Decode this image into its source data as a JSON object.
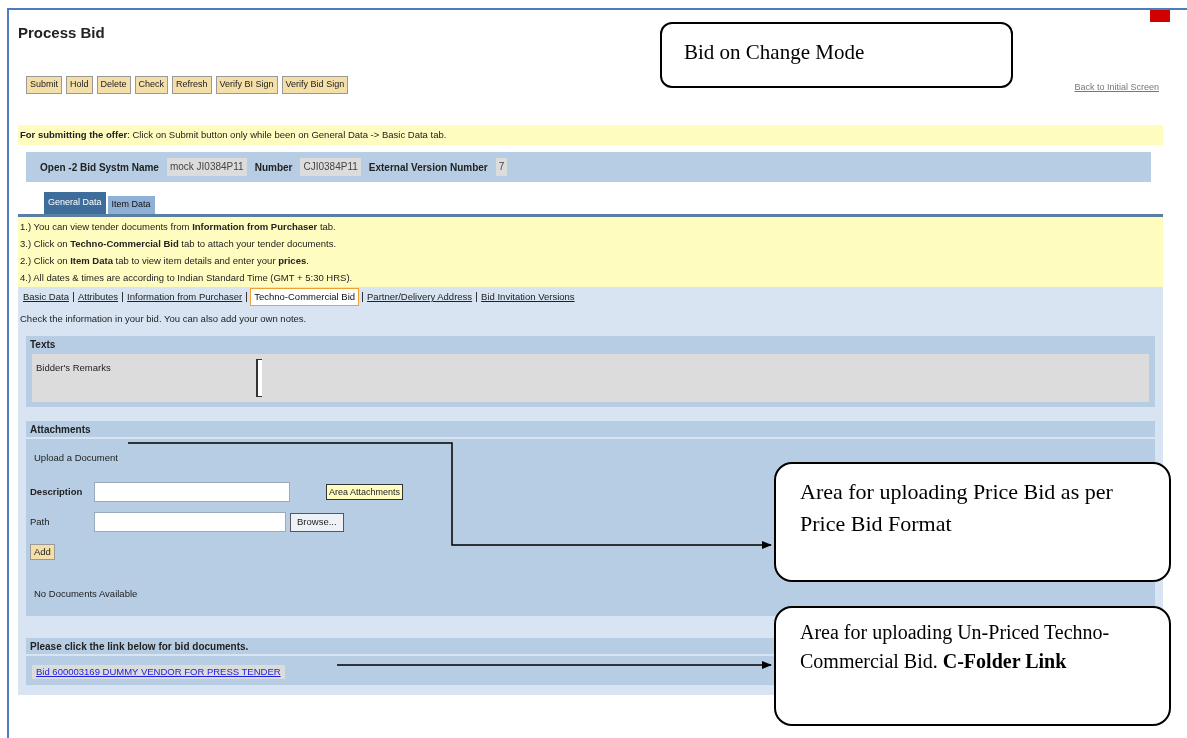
{
  "title": "Process Bid",
  "toolbar": [
    "Submit",
    "Hold",
    "Delete",
    "Check",
    "Refresh",
    "Verify BI Sign",
    "Verify Bid Sign"
  ],
  "back_link": "Back to Initial Screen",
  "submit_note": "**For submitting the offer**: Click on Submit button only while been on General Data -> Basic Data tab.",
  "header_fields": [
    {
      "label": "Open -2 Bid Systm Name",
      "value": "mock JI0384P11"
    },
    {
      "label": "Number",
      "value": "CJI0384P11"
    },
    {
      "label": "External Version Number",
      "value": "7"
    }
  ],
  "tabs": [
    {
      "label": "General Data",
      "selected": true
    },
    {
      "label": "Item Data",
      "selected": false
    }
  ],
  "info_lines": [
    "1.) You can view tender documents from **Information from Purchaser** tab.",
    "3.) Click on **Techno-Commercial Bid** tab to attach your tender documents.",
    "2.) Click on **Item Data** tab to view item details and enter your **prices**.",
    "4.) All dates & times are according to Indian Standard Time (GMT + 5:30 HRS)."
  ],
  "subtabs": [
    {
      "label": "Basic Data",
      "selected": false
    },
    {
      "label": "Attributes",
      "selected": false
    },
    {
      "label": "Information from Purchaser",
      "selected": false
    },
    {
      "label": "Techno-Commercial Bid",
      "selected": true
    },
    {
      "label": "Partner/Delivery Address",
      "selected": false
    },
    {
      "label": "Bid Invitation Versions",
      "selected": false
    }
  ],
  "intro": "Check the information in your bid. You can also add your own notes.",
  "texts_section": {
    "title": "Texts",
    "field_label": "Bidder's Remarks"
  },
  "attachments": {
    "title": "Attachments",
    "upload_label": "Upload a Document",
    "description_label": "Description",
    "area_button": "Area Attachments",
    "path_label": "Path",
    "browse_button": "Browse...",
    "add_button": "Add",
    "empty_text": "No Documents Available"
  },
  "links_section": {
    "title": "Please click the link below for bid documents.",
    "link": "Bid 600003169 DUMMY VENDOR FOR PRESS TENDER"
  },
  "callouts": [
    "Bid on Change Mode",
    "Area for uploading Price Bid as per Price Bid  Format",
    "Area for uploading Un-Priced Techno-Commercial Bid. **C-Folder Link**"
  ]
}
